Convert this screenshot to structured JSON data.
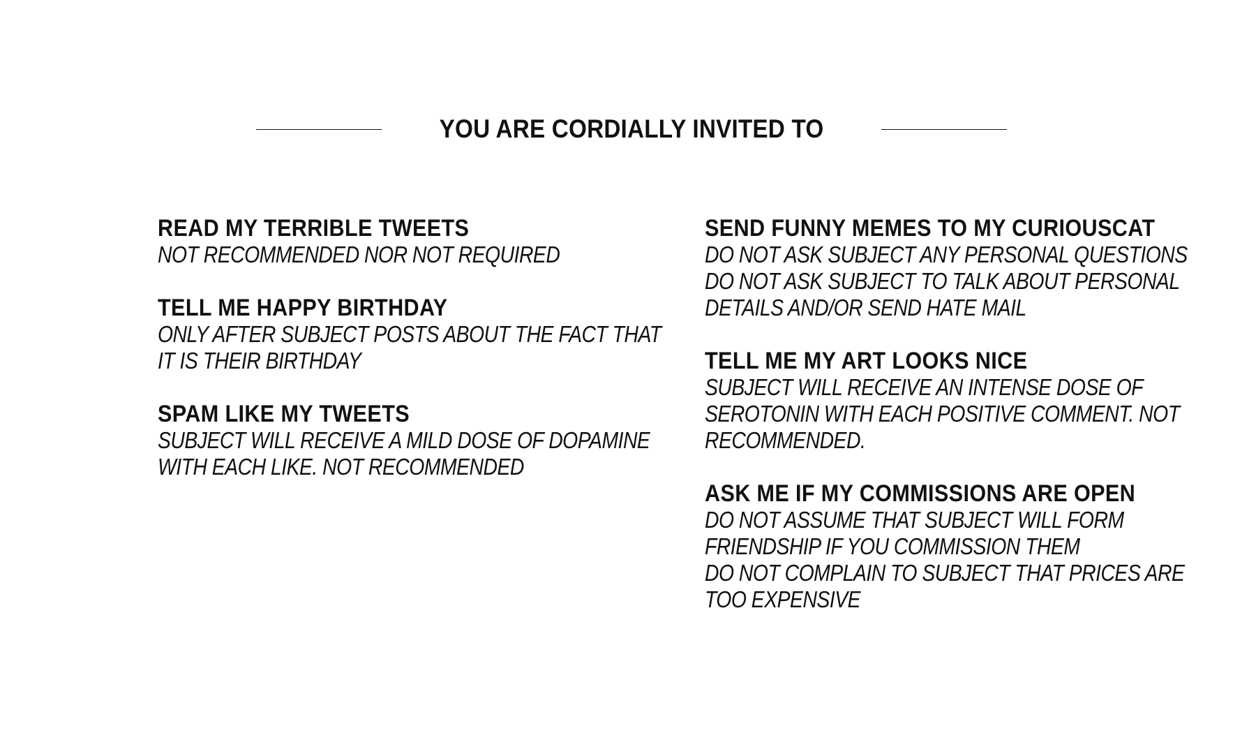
{
  "header": {
    "title": "YOU ARE CORDIALLY INVITED TO"
  },
  "left_column": [
    {
      "title": "READ MY TERRIBLE TWEETS",
      "lines": [
        "NOT RECOMMENDED NOR NOT REQUIRED"
      ]
    },
    {
      "title": "TELL ME HAPPY BIRTHDAY",
      "lines": [
        "ONLY AFTER SUBJECT POSTS ABOUT THE FACT THAT",
        "IT IS THEIR BIRTHDAY"
      ]
    },
    {
      "title": "SPAM LIKE MY TWEETS",
      "lines": [
        "SUBJECT WILL RECEIVE A MILD DOSE OF DOPAMINE",
        "WITH EACH LIKE. NOT RECOMMENDED"
      ]
    }
  ],
  "right_column": [
    {
      "title": "SEND FUNNY MEMES TO MY CURIOUSCAT",
      "lines": [
        "DO NOT ASK SUBJECT ANY PERSONAL QUESTIONS",
        "DO NOT ASK SUBJECT TO TALK ABOUT PERSONAL",
        "DETAILS AND/OR SEND HATE MAIL"
      ]
    },
    {
      "title": "TELL ME MY ART LOOKS NICE",
      "lines": [
        "SUBJECT WILL RECEIVE AN INTENSE DOSE OF",
        "SEROTONIN WITH EACH POSITIVE COMMENT. NOT",
        "RECOMMENDED."
      ]
    },
    {
      "title": "ASK ME IF MY COMMISSIONS ARE OPEN",
      "lines": [
        "DO NOT ASSUME THAT SUBJECT WILL FORM",
        "FRIENDSHIP IF YOU COMMISSION THEM",
        "DO NOT COMPLAIN TO SUBJECT THAT PRICES ARE",
        "TOO EXPENSIVE"
      ]
    }
  ]
}
